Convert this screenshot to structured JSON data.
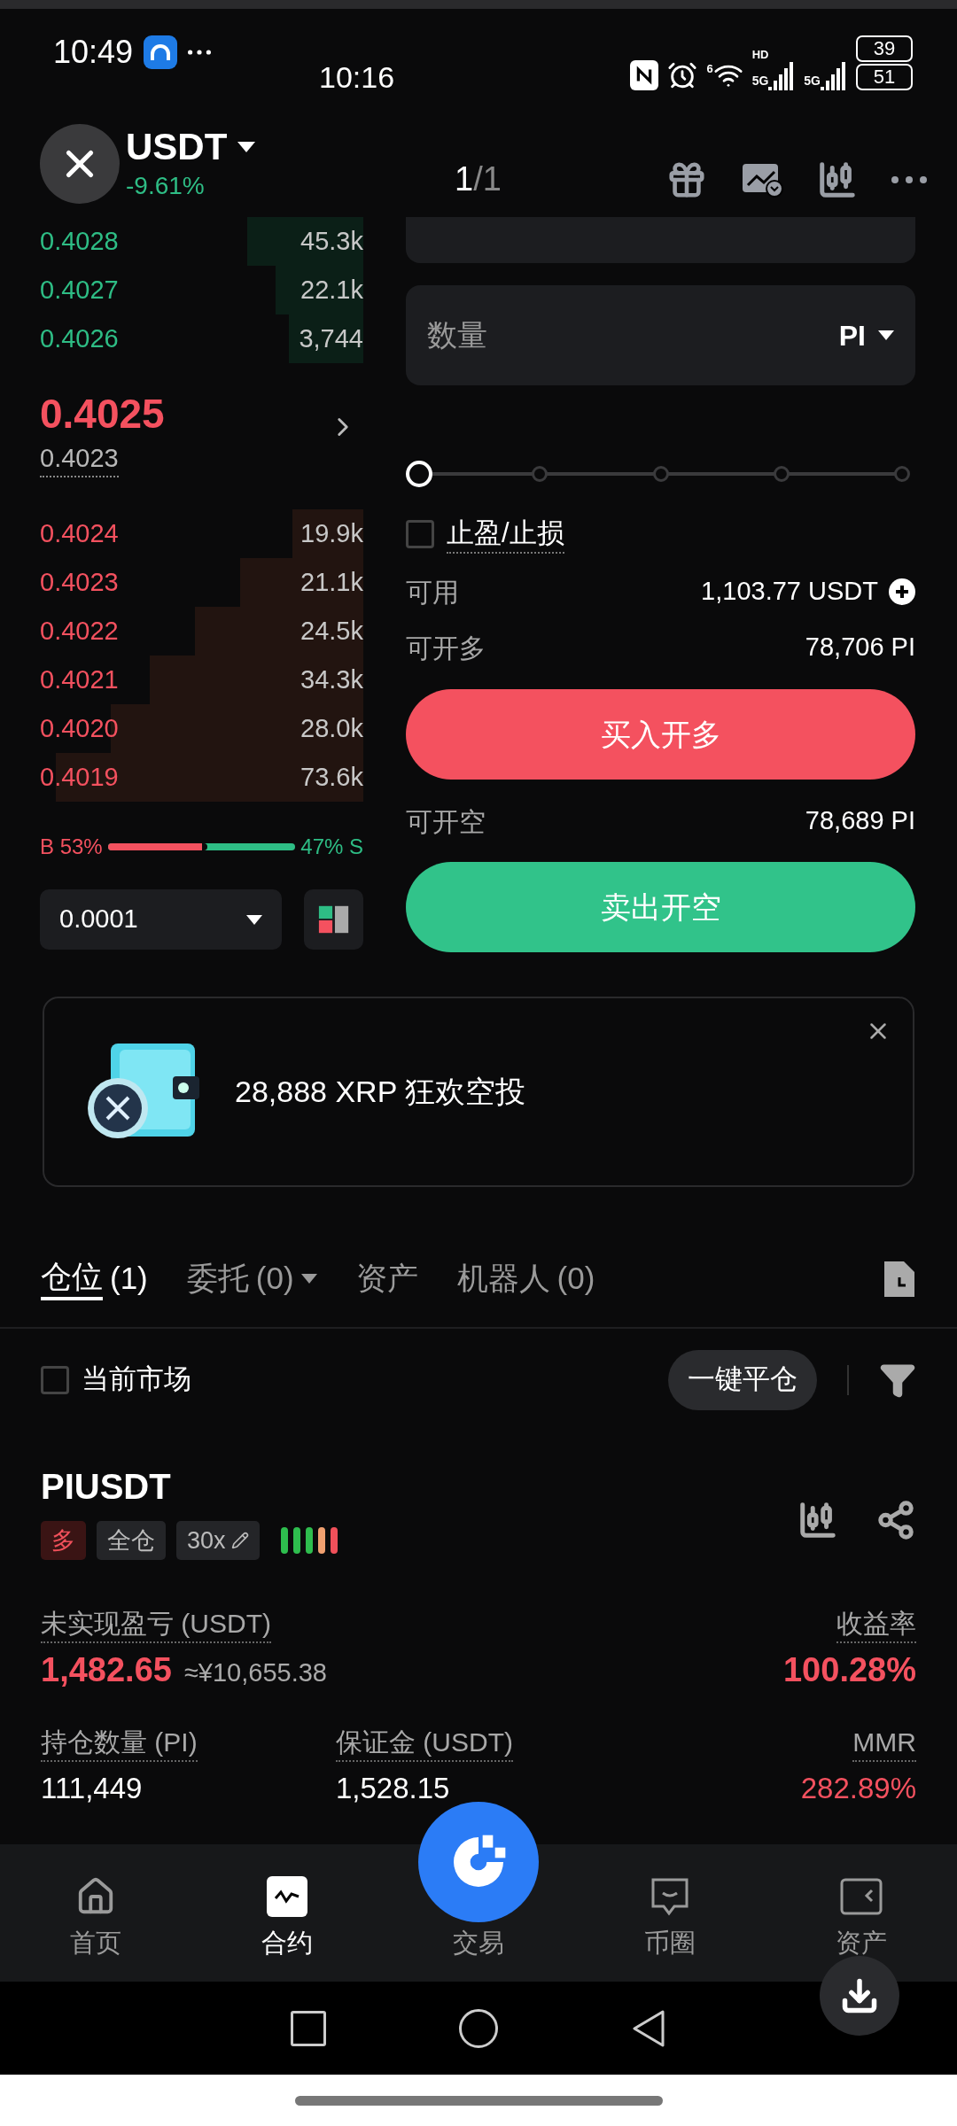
{
  "status_bar": {
    "time": "10:49",
    "overlay_time": "10:16",
    "wifi_label": "6",
    "hd_label": "HD",
    "signals": [
      "5G",
      "5G"
    ],
    "battery": [
      "39",
      "51"
    ]
  },
  "header": {
    "symbol": "USDT",
    "change": "-9.61%",
    "page_current": "1",
    "page_total": "/1"
  },
  "order_book": {
    "asks": [
      {
        "price": "0.4028",
        "amount": "45.3k"
      },
      {
        "price": "0.4027",
        "amount": "22.1k"
      },
      {
        "price": "0.4026",
        "amount": "3,744"
      }
    ],
    "last_price": "0.4025",
    "mark_price": "0.4023",
    "bids": [
      {
        "price": "0.4024",
        "amount": "19.9k"
      },
      {
        "price": "0.4023",
        "amount": "21.1k"
      },
      {
        "price": "0.4022",
        "amount": "24.5k"
      },
      {
        "price": "0.4021",
        "amount": "34.3k"
      },
      {
        "price": "0.4020",
        "amount": "28.0k"
      },
      {
        "price": "0.4019",
        "amount": "73.6k"
      }
    ],
    "buy_ratio": {
      "label": "B 53%",
      "level": 0.53
    },
    "sell_ratio": {
      "label": "47% S"
    },
    "precision": "0.0001"
  },
  "order_form": {
    "quantity_placeholder": "数量",
    "unit": "PI",
    "slider": {
      "level": 0
    },
    "tp_sl": {
      "label": "止盈/止损",
      "checked": false
    },
    "available": {
      "label": "可用",
      "value": "1,103.77 USDT"
    },
    "long_max": {
      "label": "可开多",
      "value": "78,706 PI"
    },
    "buy_button": "买入开多",
    "short_max": {
      "label": "可开空",
      "value": "78,689 PI"
    },
    "sell_button": "卖出开空"
  },
  "banner": {
    "text": "28,888 XRP 狂欢空投"
  },
  "tabs": [
    {
      "label": "仓位",
      "count": "(1)",
      "selected": true,
      "menu": false
    },
    {
      "label": "委托",
      "count": "(0)",
      "selected": false,
      "menu": true
    },
    {
      "label": "资产",
      "selected": false,
      "menu": false
    },
    {
      "label": "机器人",
      "count": "(0)",
      "selected": false,
      "menu": false
    }
  ],
  "filter": {
    "current_market": {
      "label": "当前市场",
      "checked": false
    },
    "close_all": "一键平仓"
  },
  "position": {
    "symbol": "PIUSDT",
    "tags": [
      {
        "label": "多",
        "kind": "side"
      },
      {
        "label": "全仓",
        "kind": "mode"
      },
      {
        "label": "30x",
        "kind": "leverage"
      }
    ],
    "risk_bars": [
      {
        "color": "#2ebd4e"
      },
      {
        "color": "#2ebd4e"
      },
      {
        "color": "#2ebd4e"
      },
      {
        "color": "#f0a070"
      },
      {
        "color": "#f0505a"
      }
    ],
    "pnl": {
      "label": "未实现盈亏 (USDT)",
      "value": "1,482.65",
      "approx": "≈¥10,655.38"
    },
    "roe": {
      "label": "收益率",
      "value": "100.28%"
    },
    "size": {
      "label": "持仓数量 (PI)",
      "value": "111,449"
    },
    "margin": {
      "label": "保证金 (USDT)",
      "value": "1,528.15"
    },
    "mmr": {
      "label": "MMR",
      "value": "282.89%"
    }
  },
  "nav": [
    {
      "label": "首页",
      "kind": "home",
      "selected": false
    },
    {
      "label": "合约",
      "kind": "futures",
      "selected": true
    },
    {
      "label": "交易",
      "kind": "trade",
      "selected": false
    },
    {
      "label": "币圈",
      "kind": "social",
      "selected": false
    },
    {
      "label": "资产",
      "kind": "assets",
      "selected": false
    }
  ]
}
